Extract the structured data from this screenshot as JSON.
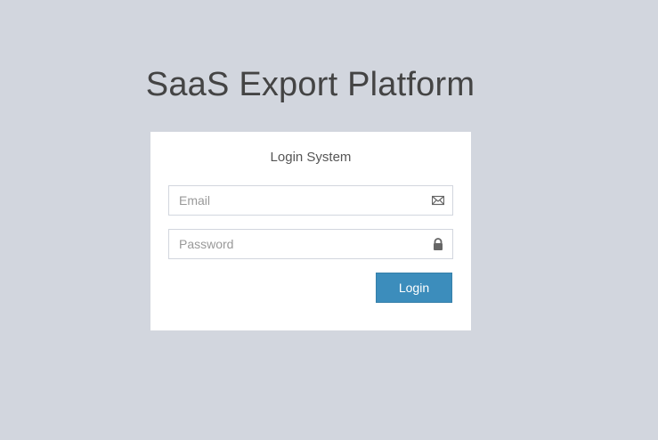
{
  "header": {
    "title": "SaaS Export Platform"
  },
  "login_box": {
    "message": "Login System",
    "email": {
      "placeholder": "Email",
      "value": "",
      "icon": "envelope-icon"
    },
    "password": {
      "placeholder": "Password",
      "value": "",
      "icon": "lock-icon"
    },
    "submit_label": "Login"
  },
  "colors": {
    "background": "#d2d6de",
    "panel": "#ffffff",
    "primary_button": "#3c8dbc",
    "input_border": "#d2d6de",
    "icon": "#666666"
  }
}
